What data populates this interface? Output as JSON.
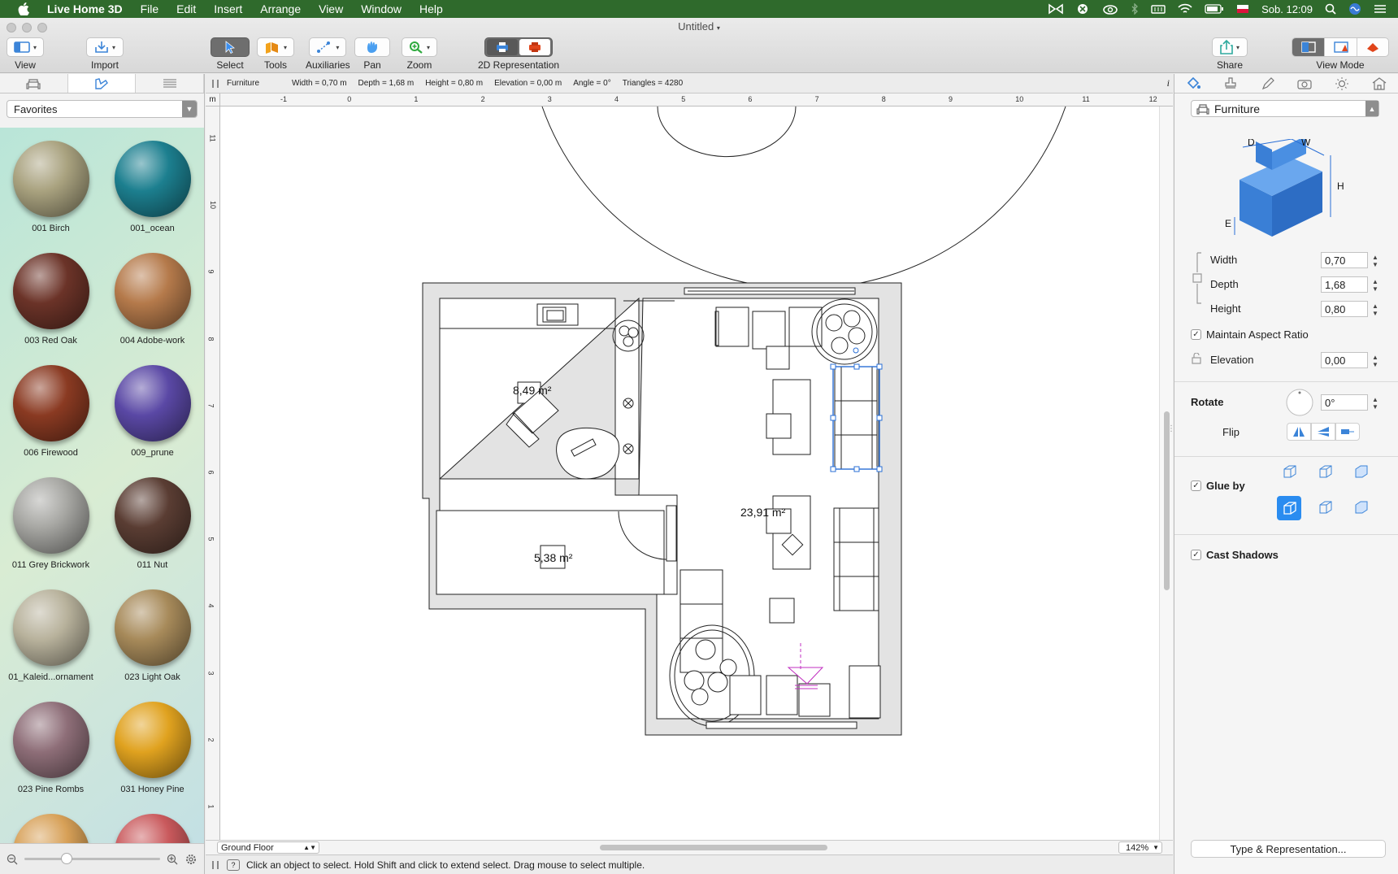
{
  "menubar": {
    "app_name": "Live Home 3D",
    "items": [
      "File",
      "Edit",
      "Insert",
      "Arrange",
      "View",
      "Window",
      "Help"
    ],
    "clock": "Sob. 12:09"
  },
  "window": {
    "title": "Untitled",
    "toolbar": {
      "view": "View",
      "import": "Import",
      "select": "Select",
      "tools": "Tools",
      "auxiliaries": "Auxiliaries",
      "pan": "Pan",
      "zoom": "Zoom",
      "representation": "2D Representation",
      "share": "Share",
      "view_mode": "View Mode"
    }
  },
  "library": {
    "category": "Favorites",
    "materials": [
      {
        "name": "001 Birch",
        "color": "#a9a27f"
      },
      {
        "name": "001_ocean",
        "color": "#1c7f8f"
      },
      {
        "name": "003 Red Oak",
        "color": "#6b3328"
      },
      {
        "name": "004 Adobe-work",
        "color": "#b57a4b"
      },
      {
        "name": "006 Firewood",
        "color": "#8a3a22"
      },
      {
        "name": "009_prune",
        "color": "#5a48a5"
      },
      {
        "name": "011 Grey Brickwork",
        "color": "#a7a7a3"
      },
      {
        "name": "011 Nut",
        "color": "#5a3d33"
      },
      {
        "name": "01_Kaleid...ornament",
        "color": "#b8b29c"
      },
      {
        "name": "023 Light Oak",
        "color": "#a78a5a"
      },
      {
        "name": "023 Pine Rombs",
        "color": "#8e6e78"
      },
      {
        "name": "031 Honey Pine",
        "color": "#e0a21f"
      },
      {
        "name": "",
        "color": "#d7a057"
      },
      {
        "name": "",
        "color": "#c9595c"
      }
    ]
  },
  "infobar": {
    "object": "Furniture",
    "width": "Width = 0,70 m",
    "depth": "Depth = 1,68 m",
    "height": "Height = 0,80 m",
    "elevation": "Elevation = 0,00 m",
    "angle": "Angle = 0°",
    "triangles": "Triangles = 4280"
  },
  "ruler": {
    "unit": "m",
    "h_ticks": [
      "-1",
      "0",
      "1",
      "2",
      "3",
      "4",
      "5",
      "6",
      "7",
      "8",
      "9",
      "10",
      "11",
      "12"
    ],
    "v_ticks": [
      "11",
      "10",
      "9",
      "8",
      "7",
      "6",
      "5",
      "4",
      "3",
      "2",
      "1"
    ]
  },
  "plan": {
    "room_areas": [
      "8,49 m²",
      "23,91 m²",
      "5,38 m²"
    ]
  },
  "bottombar": {
    "floor": "Ground Floor",
    "zoom": "142%"
  },
  "status": {
    "message": "Click an object to select. Hold Shift and click to extend select. Drag mouse to select multiple."
  },
  "inspector": {
    "object_type": "Furniture",
    "diagram_labels": {
      "d": "D",
      "w": "W",
      "h": "H",
      "e": "E"
    },
    "width_label": "Width",
    "width_value": "0,70",
    "depth_label": "Depth",
    "depth_value": "1,68",
    "height_label": "Height",
    "height_value": "0,80",
    "maintain_aspect": "Maintain Aspect Ratio",
    "elevation_label": "Elevation",
    "elevation_value": "0,00",
    "rotate_label": "Rotate",
    "rotate_value": "0°",
    "flip_label": "Flip",
    "glue_label": "Glue by",
    "shadows_label": "Cast Shadows",
    "type_button": "Type & Representation..."
  },
  "colors": {
    "menubar_bg": "#2f6a2c",
    "selection": "#2a6fd6",
    "camera": "#c12fc0"
  }
}
